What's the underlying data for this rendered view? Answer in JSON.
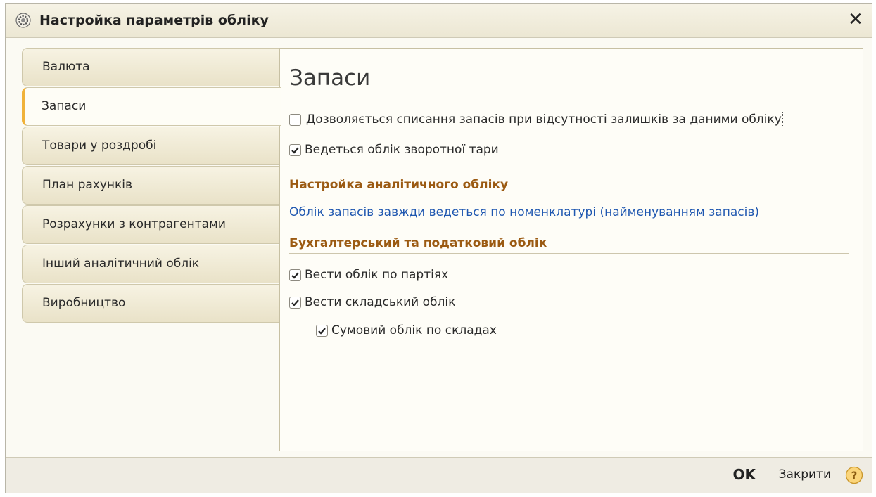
{
  "window": {
    "title": "Настройка параметрів обліку",
    "close_glyph": "✕"
  },
  "tabs": [
    {
      "label": "Валюта",
      "active": false
    },
    {
      "label": "Запаси",
      "active": true
    },
    {
      "label": "Товари у роздробі",
      "active": false
    },
    {
      "label": "План рахунків",
      "active": false
    },
    {
      "label": "Розрахунки з контрагентами",
      "active": false
    },
    {
      "label": "Інший аналітичний облік",
      "active": false
    },
    {
      "label": "Виробництво",
      "active": false
    }
  ],
  "panel": {
    "title": "Запаси",
    "allow_writeoff": {
      "label": "Дозволяється списання запасів при відсутності залишків за даними обліку",
      "checked": false
    },
    "return_packaging": {
      "label": "Ведеться облік зворотної тари",
      "checked": true
    },
    "analytics_header": "Настройка аналітичного обліку",
    "analytics_info": "Облік запасів завжди ведеться по номенклатурі (найменуванням запасів)",
    "accounting_header": "Бухгалтерський та податковий облік",
    "by_batches": {
      "label": "Вести облік по партіях",
      "checked": true
    },
    "warehouse": {
      "label": "Вести складський облік",
      "checked": true
    },
    "sum_by_warehouses": {
      "label": "Сумовий облік по складах",
      "checked": true
    }
  },
  "footer": {
    "ok_label": "OK",
    "close_label": "Закрити",
    "help_glyph": "?"
  },
  "colors": {
    "section_header": "#9b5a12",
    "link": "#1f57b0",
    "active_tab_marker": "#f0b23a"
  }
}
